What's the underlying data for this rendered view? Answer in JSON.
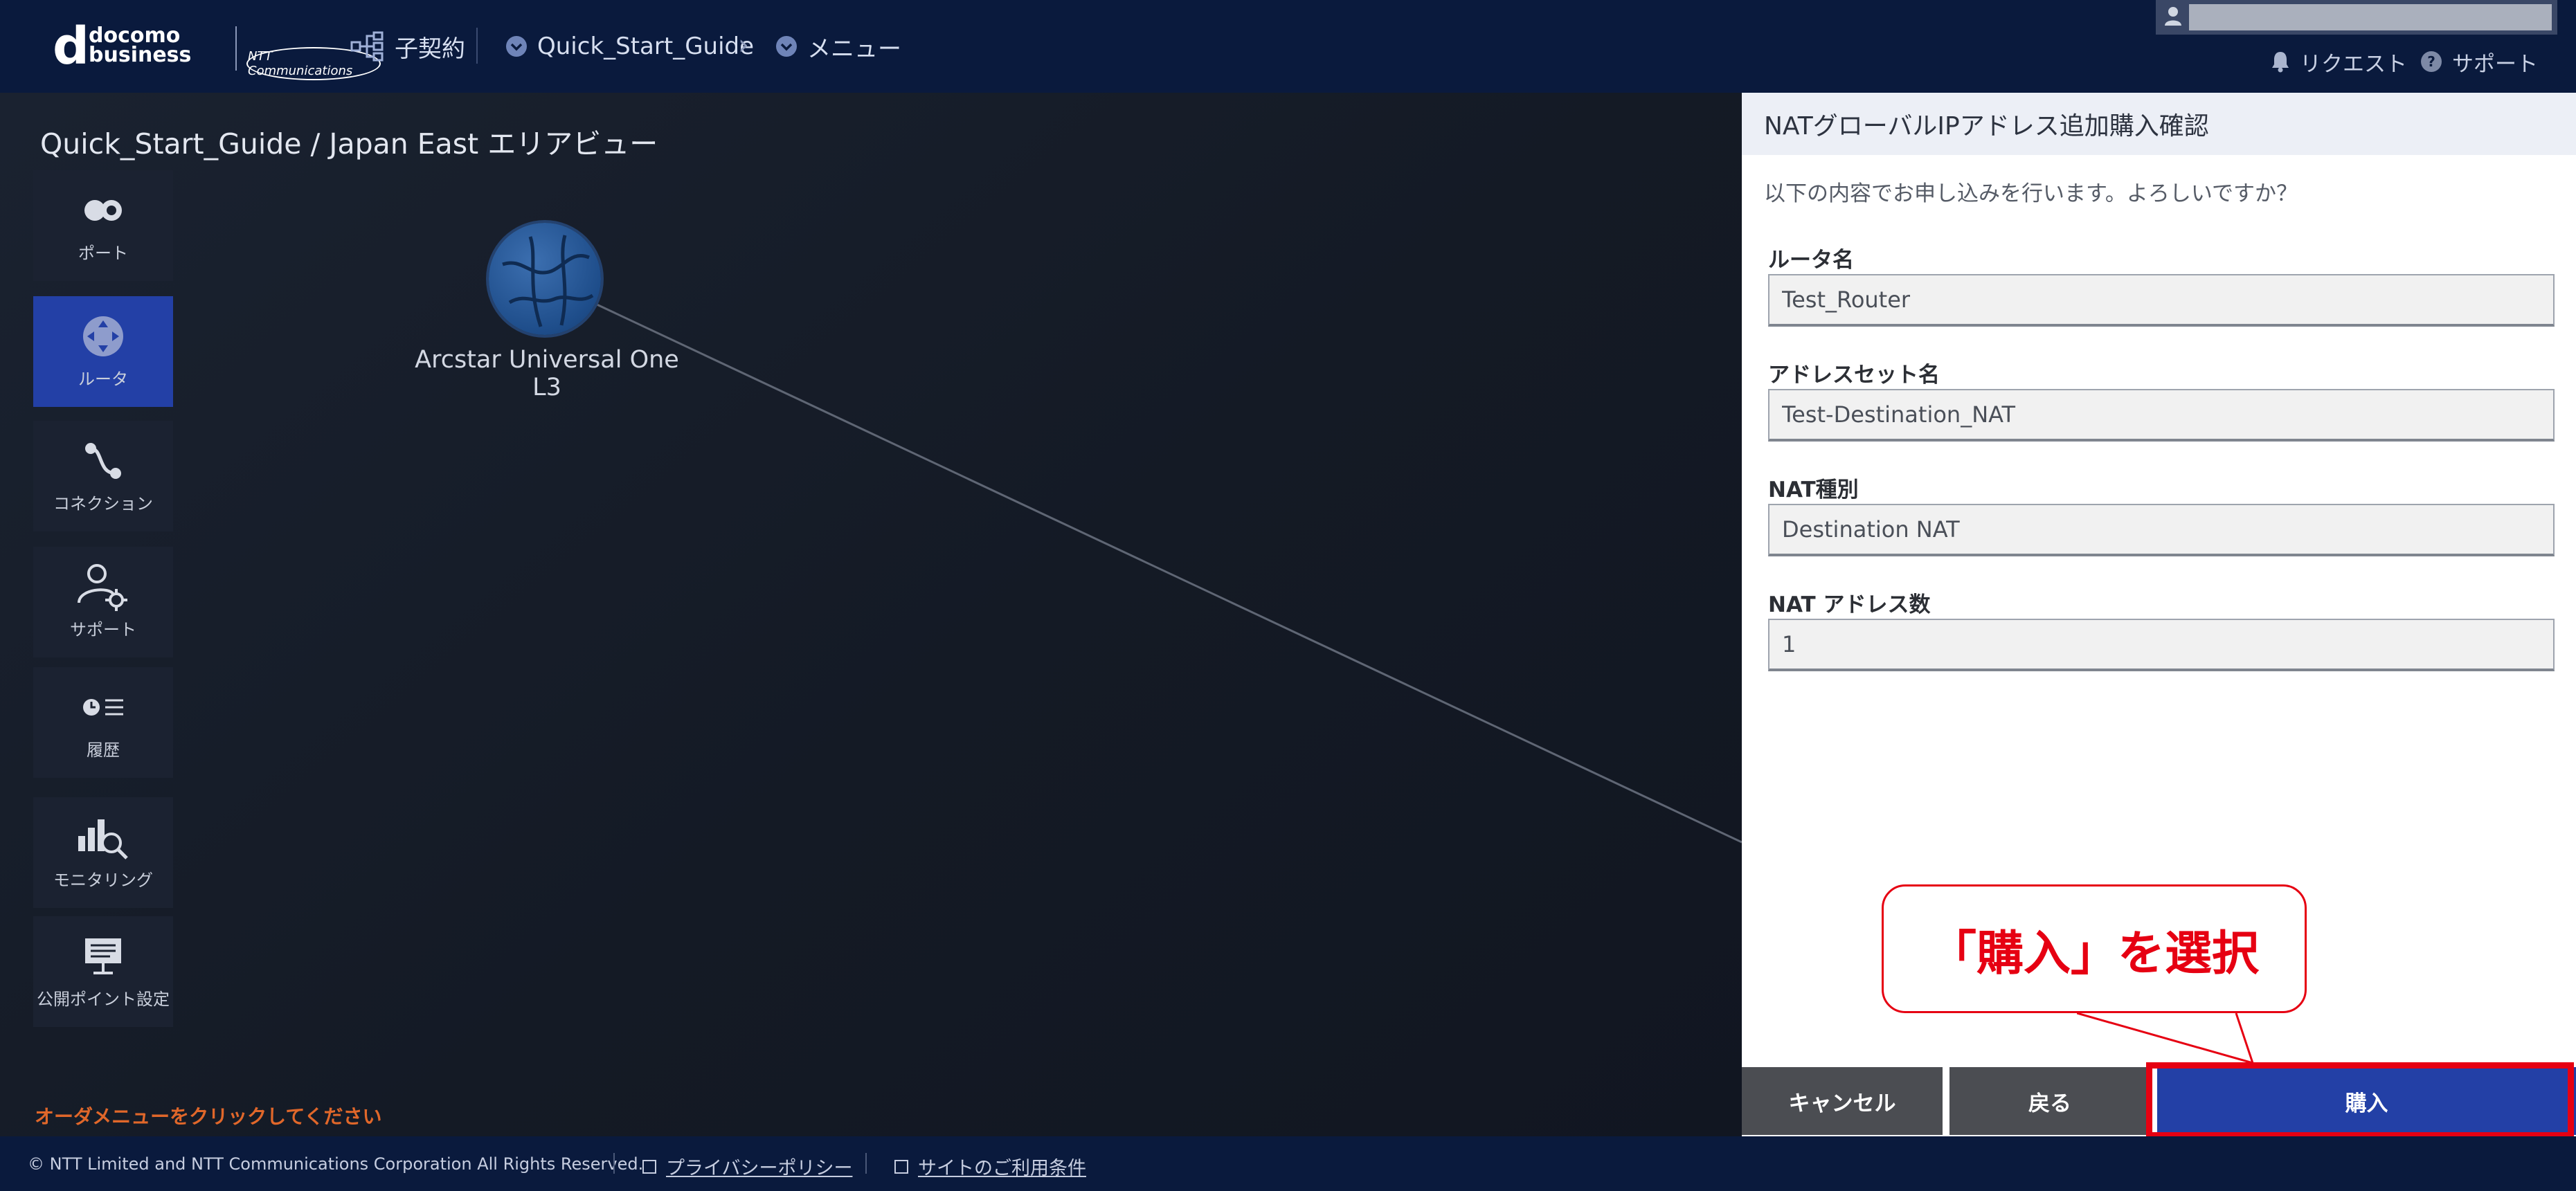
{
  "header": {
    "logo_d": "d",
    "logo_line1": "docomo",
    "logo_line2": "business",
    "ntt_logo": "NTT Communications",
    "contract_label": "子契約",
    "breadcrumb_project": "Quick_Start_Guide",
    "breadcrumb_menu": "メニュー",
    "request_label": "リクエスト",
    "support_label": "サポート"
  },
  "canvas": {
    "title": "Quick_Start_Guide / Japan East エリアビュー",
    "node_label": "Arcstar Universal One L3",
    "hint": "オーダメニューをクリックしてください"
  },
  "sidebar": {
    "items": [
      {
        "label": "ポート",
        "icon": "port-icon"
      },
      {
        "label": "ルータ",
        "icon": "router-icon"
      },
      {
        "label": "コネクション",
        "icon": "connection-icon"
      },
      {
        "label": "サポート",
        "icon": "support-icon"
      },
      {
        "label": "履歴",
        "icon": "history-icon"
      },
      {
        "label": "モニタリング",
        "icon": "monitoring-icon"
      },
      {
        "label": "公開ポイント設定",
        "icon": "public-point-icon"
      }
    ]
  },
  "panel": {
    "title": "NATグローバルIPアドレス追加購入確認",
    "message": "以下の内容でお申し込みを行います。よろしいですか？",
    "fields": [
      {
        "label": "ルータ名",
        "value": "Test_Router"
      },
      {
        "label": "アドレスセット名",
        "value": "Test-Destination_NAT"
      },
      {
        "label": "NAT種別",
        "value": "Destination NAT"
      },
      {
        "label": "NAT アドレス数",
        "value": "1"
      }
    ],
    "cancel_label": "キャンセル",
    "back_label": "戻る",
    "buy_label": "購入"
  },
  "annotation": {
    "callout_text": "「購入」を選択",
    "color": "#e60012"
  },
  "footer": {
    "copyright": "© NTT Limited and NTT Communications Corporation All Rights Reserved.",
    "privacy_label": "プライバシーポリシー",
    "terms_label": "サイトのご利用条件"
  },
  "colors": {
    "header_bg": "#0a1a3d",
    "accent": "#2340a6",
    "warning": "#e0672a"
  }
}
